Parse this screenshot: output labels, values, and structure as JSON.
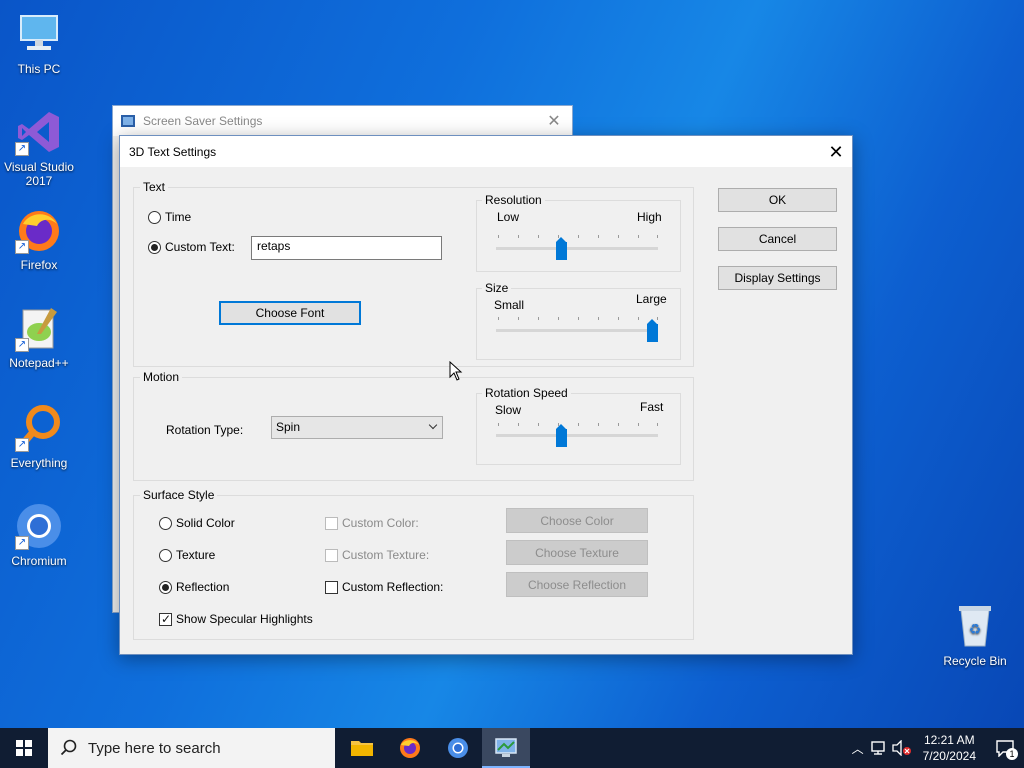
{
  "desktop": {
    "icons": [
      {
        "label": "This PC"
      },
      {
        "label": "Visual Studio 2017"
      },
      {
        "label": "Firefox"
      },
      {
        "label": "Notepad++"
      },
      {
        "label": "Everything"
      },
      {
        "label": "Chromium"
      },
      {
        "label": "Recycle Bin"
      }
    ]
  },
  "background_window": {
    "title": "Screen Saver Settings"
  },
  "dialog": {
    "title": "3D Text Settings",
    "text_group": {
      "legend": "Text",
      "time_label": "Time",
      "custom_text_label": "Custom Text:",
      "custom_text_value": "retaps",
      "selected": "Custom Text",
      "choose_font": "Choose Font"
    },
    "resolution": {
      "legend": "Resolution",
      "min_label": "Low",
      "max_label": "High",
      "value": 0.4
    },
    "size": {
      "legend": "Size",
      "min_label": "Small",
      "max_label": "Large",
      "value": 1.0
    },
    "motion": {
      "legend": "Motion",
      "rotation_type_label": "Rotation Type:",
      "rotation_type_value": "Spin"
    },
    "rotation_speed": {
      "legend": "Rotation Speed",
      "min_label": "Slow",
      "max_label": "Fast",
      "value": 0.4
    },
    "surface": {
      "legend": "Surface Style",
      "solid_color": "Solid Color",
      "texture": "Texture",
      "reflection": "Reflection",
      "selected": "Reflection",
      "custom_color": "Custom Color:",
      "custom_texture": "Custom Texture:",
      "custom_reflection": "Custom Reflection:",
      "choose_color": "Choose Color",
      "choose_texture": "Choose Texture",
      "choose_reflection": "Choose Reflection",
      "specular_label": "Show Specular Highlights",
      "specular_checked": true
    },
    "buttons": {
      "ok": "OK",
      "cancel": "Cancel",
      "display_settings": "Display Settings"
    }
  },
  "taskbar": {
    "search_placeholder": "Type here to search",
    "time": "12:21 AM",
    "date": "7/20/2024",
    "notification_count": "1"
  }
}
